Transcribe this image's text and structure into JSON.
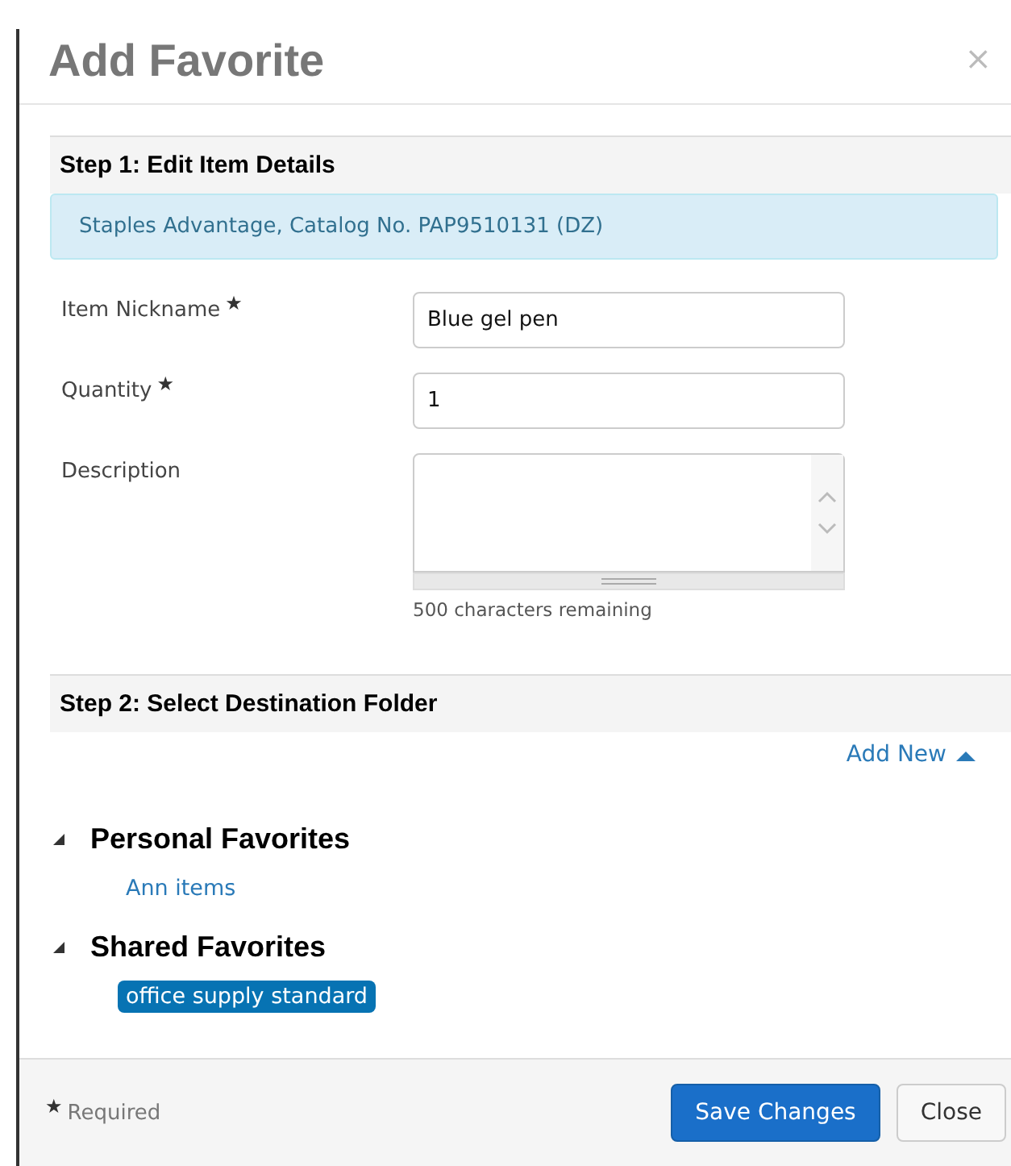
{
  "dialog": {
    "title": "Add Favorite",
    "close": "×"
  },
  "step1": {
    "heading": "Step 1: Edit Item Details",
    "info": "Staples Advantage, Catalog No. PAP9510131 (DZ)",
    "fields": [
      {
        "kind": "input",
        "label": "Item Nickname",
        "required_mark": "★",
        "value": "Blue gel pen"
      },
      {
        "kind": "input",
        "label": "Quantity",
        "required_mark": "★",
        "value": "1"
      },
      {
        "kind": "textarea",
        "label": "Description",
        "hint": "500 characters remaining"
      }
    ]
  },
  "step2": {
    "heading": "Step 2: Select Destination Folder",
    "add_new": "Add New",
    "add_new_expanded": true,
    "folders": [
      {
        "label": "Personal Favorites",
        "expanded": true,
        "children": [
          {
            "label": "Ann items",
            "selected": false
          }
        ]
      },
      {
        "label": "Shared Favorites",
        "expanded": true,
        "children": [
          {
            "label": "office supply standard",
            "selected": true
          }
        ]
      }
    ]
  },
  "footer": {
    "required_mark": "★",
    "required_text": "Required",
    "buttons": [
      {
        "kind": "primary",
        "label": "Save Changes"
      },
      {
        "kind": "default",
        "label": "Close"
      }
    ]
  }
}
